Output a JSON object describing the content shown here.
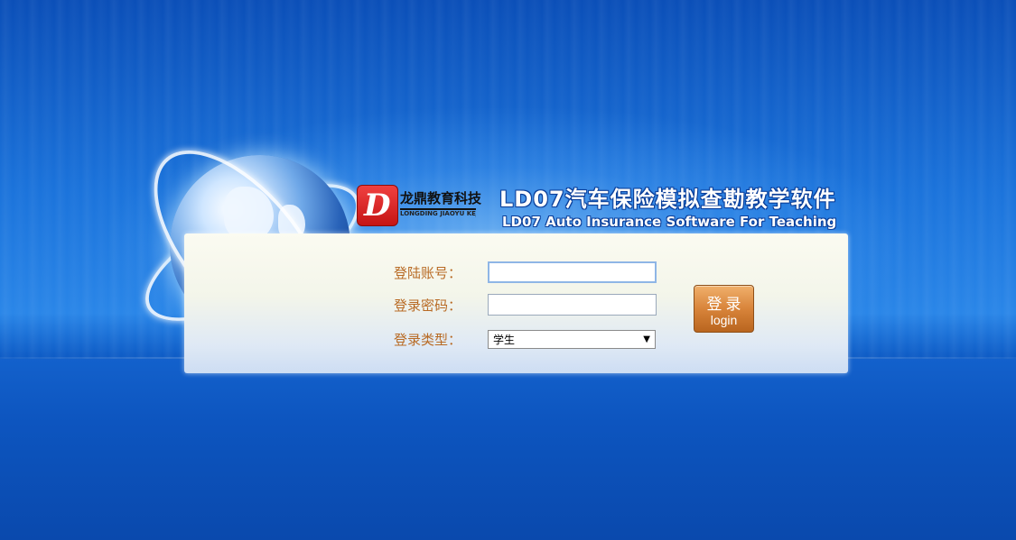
{
  "brand": {
    "company_name": "龙鼎教育科技",
    "company_sub": "LONGDING JIAOYU KEJI",
    "logo_letter": "D"
  },
  "title": {
    "cn": "LD07汽车保险模拟查勘教学软件",
    "en": "LD07 Auto Insurance Software For Teaching"
  },
  "form": {
    "account_label": "登陆账号：",
    "account_value": "",
    "password_label": "登录密码：",
    "password_value": "",
    "type_label": "登录类型：",
    "type_selected": "学生",
    "type_caret": "▼"
  },
  "login_button": {
    "cn": "登录",
    "en": "login"
  },
  "colors": {
    "label": "#b86a24",
    "button": "#d8843a",
    "background": "#1b73db"
  }
}
